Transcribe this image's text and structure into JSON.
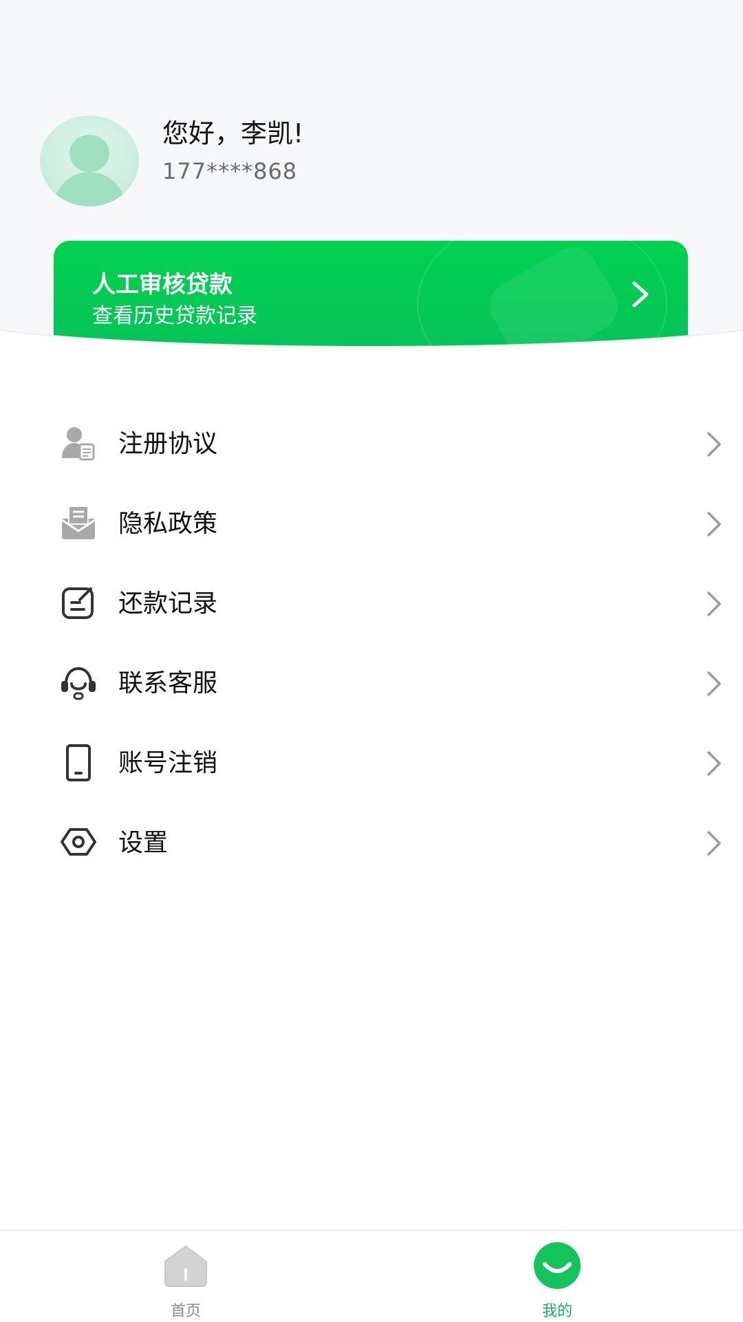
{
  "profile": {
    "greeting": "您好，李凯!",
    "phone": "177****868",
    "avatar_icon": "user-avatar-icon"
  },
  "loan_card": {
    "title": "人工审核贷款",
    "subtitle": "查看历史贷款记录",
    "color_primary": "#00d150",
    "arrow_icon": "chevron-right-icon"
  },
  "menu": {
    "items": [
      {
        "label": "注册协议",
        "icon": "user-document-icon"
      },
      {
        "label": "隐私政策",
        "icon": "mail-icon"
      },
      {
        "label": "还款记录",
        "icon": "edit-note-icon"
      },
      {
        "label": "联系客服",
        "icon": "headset-icon"
      },
      {
        "label": "账号注销",
        "icon": "phone-icon"
      },
      {
        "label": "设置",
        "icon": "settings-icon"
      }
    ]
  },
  "bottom_nav": {
    "home_label": "首页",
    "mine_label": "我的",
    "active_color": "#15b35c",
    "inactive_color": "#8a8a8a"
  }
}
